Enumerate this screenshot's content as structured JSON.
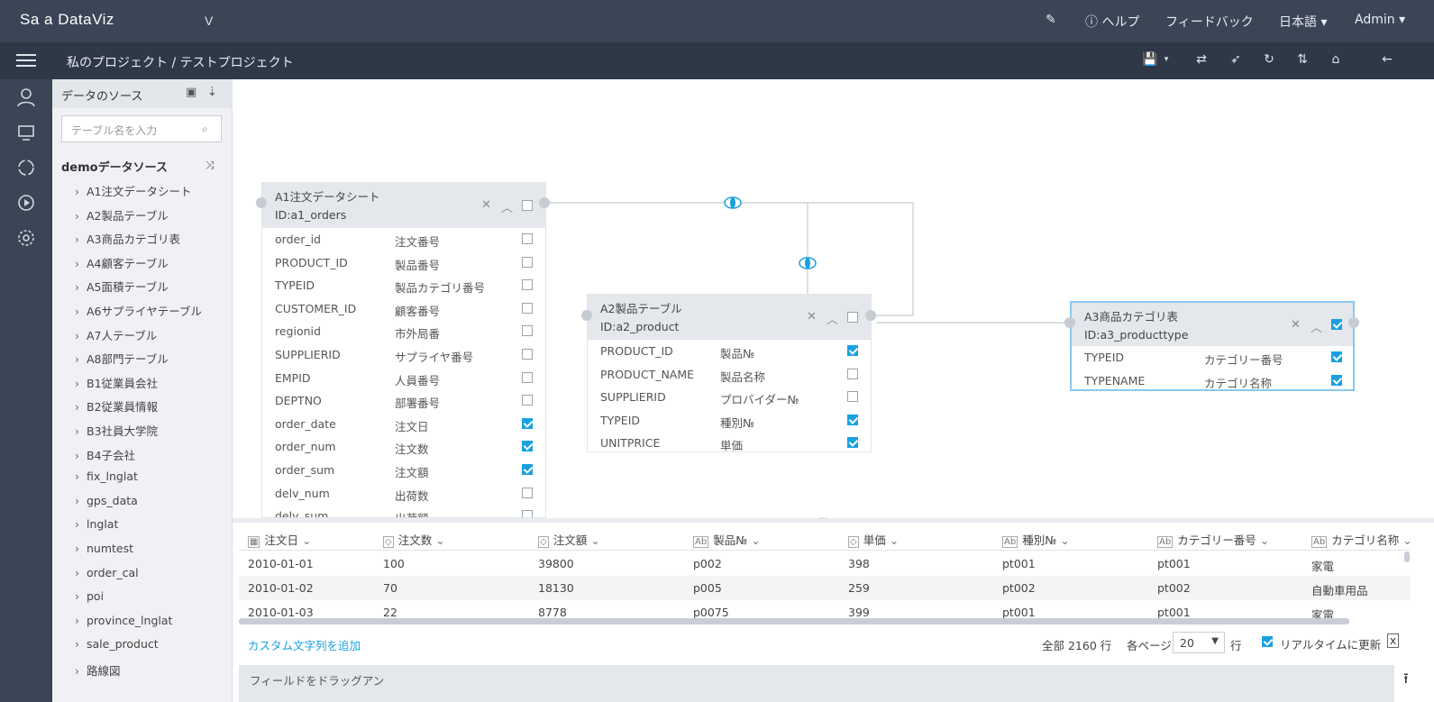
{
  "app": {
    "logo": "Sa  a DataViz",
    "version_mark": "V"
  },
  "topnav": {
    "help": "ヘルプ",
    "feedback": "フィードバック",
    "language": "日本語",
    "user": "Admin"
  },
  "breadcrumb": "私のプロジェクト  /  テストプロジェクト",
  "sidebar": {
    "title": "データのソース",
    "search_placeholder": "テーブル名を入力",
    "datasource": "demoデータソース",
    "tables": [
      "A1注文データシート",
      "A2製品テーブル",
      "A3商品カテゴリ表",
      "A4顧客テーブル",
      "A5面積テーブル",
      "A6サプライヤテーブル",
      "A7人テーブル",
      "A8部門テーブル",
      "B1従業員会社",
      "B2従業員情報",
      "B3社員大学院",
      "B4子会社",
      "fix_lnglat",
      "gps_data",
      "lnglat",
      "numtest",
      "order_cal",
      "poi",
      "province_lnglat",
      "sale_product",
      "路線図"
    ]
  },
  "tables": {
    "a1": {
      "name": "A1注文データシート",
      "id": "ID:a1_orders",
      "fields": [
        {
          "col": "order_id",
          "label": "注文番号",
          "checked": false
        },
        {
          "col": "PRODUCT_ID",
          "label": "製品番号",
          "checked": false
        },
        {
          "col": "TYPEID",
          "label": "製品カテゴリ番号",
          "checked": false
        },
        {
          "col": "CUSTOMER_ID",
          "label": "顧客番号",
          "checked": false
        },
        {
          "col": "regionid",
          "label": "市外局番",
          "checked": false
        },
        {
          "col": "SUPPLIERID",
          "label": "サプライヤ番号",
          "checked": false
        },
        {
          "col": "EMPID",
          "label": "人員番号",
          "checked": false
        },
        {
          "col": "DEPTNO",
          "label": "部署番号",
          "checked": false
        },
        {
          "col": "order_date",
          "label": "注文日",
          "checked": true
        },
        {
          "col": "order_num",
          "label": "注文数",
          "checked": true
        },
        {
          "col": "order_sum",
          "label": "注文額",
          "checked": true
        },
        {
          "col": "delv_num",
          "label": "出荷数",
          "checked": false
        },
        {
          "col": "delv_sum",
          "label": "出荷額",
          "checked": false
        }
      ]
    },
    "a2": {
      "name": "A2製品テーブル",
      "id": "ID:a2_product",
      "fields": [
        {
          "col": "PRODUCT_ID",
          "label": "製品№",
          "checked": true
        },
        {
          "col": "PRODUCT_NAME",
          "label": "製品名称",
          "checked": false
        },
        {
          "col": "SUPPLIERID",
          "label": "プロバイダー№",
          "checked": false
        },
        {
          "col": "TYPEID",
          "label": "種別№",
          "checked": true
        },
        {
          "col": "UNITPRICE",
          "label": "単価",
          "checked": true
        }
      ]
    },
    "a3": {
      "name": "A3商品カテゴリ表",
      "id": "ID:a3_producttype",
      "fields": [
        {
          "col": "TYPEID",
          "label": "カテゴリー番号",
          "checked": true
        },
        {
          "col": "TYPENAME",
          "label": "カテゴリ名称",
          "checked": true
        }
      ]
    }
  },
  "grid": {
    "headers": [
      "注文日",
      "注文数",
      "注文額",
      "製品№",
      "単価",
      "種別№",
      "カテゴリー番号",
      "カテゴリ名称"
    ],
    "rows": [
      [
        "2010-01-01",
        "100",
        "39800",
        "p002",
        "398",
        "pt001",
        "pt001",
        "家電"
      ],
      [
        "2010-01-02",
        "70",
        "18130",
        "p005",
        "259",
        "pt002",
        "pt002",
        "自動車用品"
      ],
      [
        "2010-01-03",
        "22",
        "8778",
        "p0075",
        "399",
        "pt001",
        "pt001",
        "家電"
      ]
    ]
  },
  "footer": {
    "add_custom": "カスタム文字列を追加",
    "total": "全部 2160 行",
    "per_page": "各ページ",
    "page_size": "20",
    "row_unit": "行",
    "realtime": "リアルタイムに更新",
    "dropzone": "フィールドをドラッグアン"
  },
  "colors": {
    "topbar": "#3a4556",
    "accent": "#1aa0e0"
  }
}
